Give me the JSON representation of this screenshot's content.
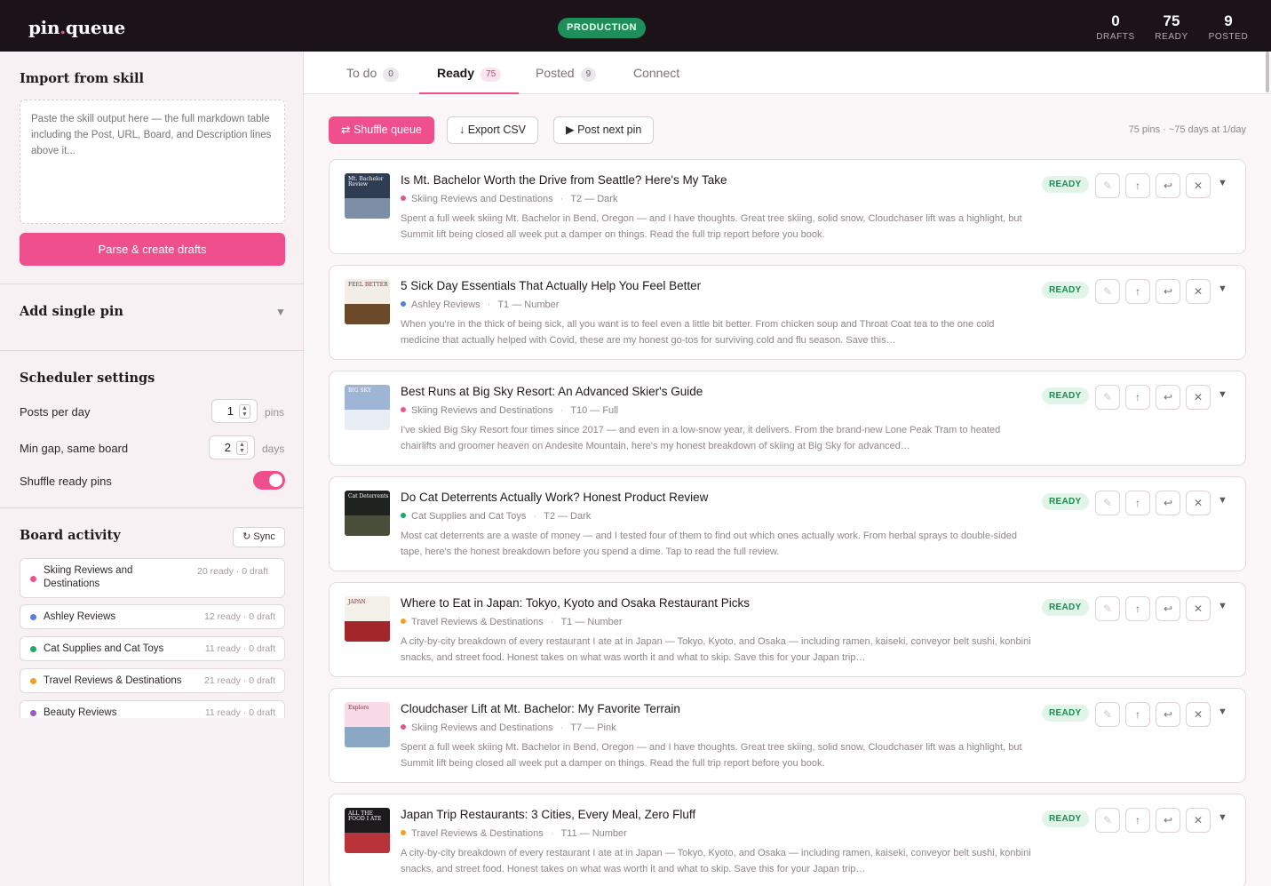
{
  "header": {
    "logo_main": "pin",
    "logo_dot": ".",
    "logo_tail": "queue",
    "environment": "PRODUCTION",
    "stats": [
      {
        "value": "0",
        "label": "DRAFTS"
      },
      {
        "value": "75",
        "label": "READY"
      },
      {
        "value": "9",
        "label": "POSTED"
      }
    ]
  },
  "sidebar": {
    "import": {
      "title": "Import from skill",
      "placeholder": "Paste the skill output here — the full markdown table including the Post, URL, Board, and Description lines above it...",
      "button": "Parse & create drafts"
    },
    "add_single": {
      "title": "Add single pin",
      "caret": "▼"
    },
    "scheduler": {
      "title": "Scheduler settings",
      "posts_per_day_label": "Posts per day",
      "posts_per_day_value": "1",
      "posts_per_day_unit": "pins",
      "min_gap_label": "Min gap, same board",
      "min_gap_value": "2",
      "min_gap_unit": "days",
      "shuffle_label": "Shuffle ready pins",
      "shuffle_on": true
    },
    "boards": {
      "title": "Board activity",
      "sync_label": "↻ Sync",
      "items": [
        {
          "name": "Skiing Reviews and Destinations",
          "count": "20 ready · 0 draft",
          "color": "#e8558f"
        },
        {
          "name": "Ashley Reviews",
          "count": "12 ready · 0 draft",
          "color": "#5b7fe0"
        },
        {
          "name": "Cat Supplies and Cat Toys",
          "count": "11 ready · 0 draft",
          "color": "#22a866"
        },
        {
          "name": "Travel Reviews & Destinations",
          "count": "21 ready · 0 draft",
          "color": "#f2a023"
        },
        {
          "name": "Beauty Reviews",
          "count": "11 ready · 0 draft",
          "color": "#9b59c7"
        }
      ]
    }
  },
  "tabs": [
    {
      "label": "To do",
      "count": "0"
    },
    {
      "label": "Ready",
      "count": "75"
    },
    {
      "label": "Posted",
      "count": "9"
    },
    {
      "label": "Connect",
      "count": ""
    }
  ],
  "toolbar": {
    "shuffle": "⇄ Shuffle queue",
    "export": "↓ Export CSV",
    "post_next": "▶ Post next pin",
    "note": "75 pins · ~75 days at 1/day"
  },
  "status_label": "READY",
  "icons": {
    "edit": "✎",
    "up": "↑",
    "back": "↩",
    "remove": "✕",
    "expand": "▼"
  },
  "cards": [
    {
      "title": "Is Mt. Bachelor Worth the Drive from Seattle? Here's My Take",
      "board": "Skiing Reviews and Destinations",
      "board_color": "#e8558f",
      "variant": "T2 — Dark",
      "desc": "Spent a full week skiing Mt. Bachelor in Bend, Oregon — and I have thoughts. Great tree skiing, solid snow, Cloudchaser lift was a highlight, but Summit lift being closed all week put a damper on things. Read the full trip report before you book.",
      "thumb": [
        "#2f3d52",
        "#7d8fa6"
      ],
      "thumb_text": "Mt. Bachelor Review"
    },
    {
      "title": "5 Sick Day Essentials That Actually Help You Feel Better",
      "board": "Ashley Reviews",
      "board_color": "#5b7fe0",
      "variant": "T1 — Number",
      "desc": "When you're in the thick of being sick, all you want is to feel even a little bit better. From chicken soup and Throat Coat tea to the one cold medicine that actually helped with Covid, these are my honest go-tos for surviving cold and flu season. Save this…",
      "thumb": [
        "#f2ede6",
        "#6b4a2a"
      ],
      "thumb_text": "FEEL BETTER"
    },
    {
      "title": "Best Runs at Big Sky Resort: An Advanced Skier's Guide",
      "board": "Skiing Reviews and Destinations",
      "board_color": "#e8558f",
      "variant": "T10 — Full",
      "desc": "I've skied Big Sky Resort four times since 2017 — and even in a low-snow year, it delivers. From the brand-new Lone Peak Tram to heated chairlifts and groomer heaven on Andesite Mountain, here's my honest breakdown of skiing at Big Sky for advanced…",
      "thumb": [
        "#9fb5d6",
        "#e9eef5"
      ],
      "thumb_text": "BIG SKY"
    },
    {
      "title": "Do Cat Deterrents Actually Work? Honest Product Review",
      "board": "Cat Supplies and Cat Toys",
      "board_color": "#22a866",
      "variant": "T2 — Dark",
      "desc": "Most cat deterrents are a waste of money — and I tested four of them to find out which ones actually work. From herbal sprays to double-sided tape, here's the honest breakdown before you spend a dime. Tap to read the full review.",
      "thumb": [
        "#1e231f",
        "#4a4f3c"
      ],
      "thumb_text": "Cat Deterrents"
    },
    {
      "title": "Where to Eat in Japan: Tokyo, Kyoto and Osaka Restaurant Picks",
      "board": "Travel Reviews & Destinations",
      "board_color": "#f2a023",
      "variant": "T1 — Number",
      "desc": "A city-by-city breakdown of every restaurant I ate at in Japan — Tokyo, Kyoto, and Osaka — including ramen, kaiseki, conveyor belt sushi, konbini snacks, and street food. Honest takes on what was worth it and what to skip. Save this for your Japan trip…",
      "thumb": [
        "#f4f0ea",
        "#a3262b"
      ],
      "thumb_text": "JAPAN"
    },
    {
      "title": "Cloudchaser Lift at Mt. Bachelor: My Favorite Terrain",
      "board": "Skiing Reviews and Destinations",
      "board_color": "#e8558f",
      "variant": "T7 — Pink",
      "desc": "Spent a full week skiing Mt. Bachelor in Bend, Oregon — and I have thoughts. Great tree skiing, solid snow, Cloudchaser lift was a highlight, but Summit lift being closed all week put a damper on things. Read the full trip report before you book.",
      "thumb": [
        "#f9dbe7",
        "#8aa7c4"
      ],
      "thumb_text": "Explore"
    },
    {
      "title": "Japan Trip Restaurants: 3 Cities, Every Meal, Zero Fluff",
      "board": "Travel Reviews & Destinations",
      "board_color": "#f2a023",
      "variant": "T11 — Number",
      "desc": "A city-by-city breakdown of every restaurant I ate at in Japan — Tokyo, Kyoto, and Osaka — including ramen, kaiseki, conveyor belt sushi, konbini snacks, and street food. Honest takes on what was worth it and what to skip. Save this for your Japan trip…",
      "thumb": [
        "#1c1a1d",
        "#b8343a"
      ],
      "thumb_text": "ALL THE FOOD I ATE"
    }
  ]
}
